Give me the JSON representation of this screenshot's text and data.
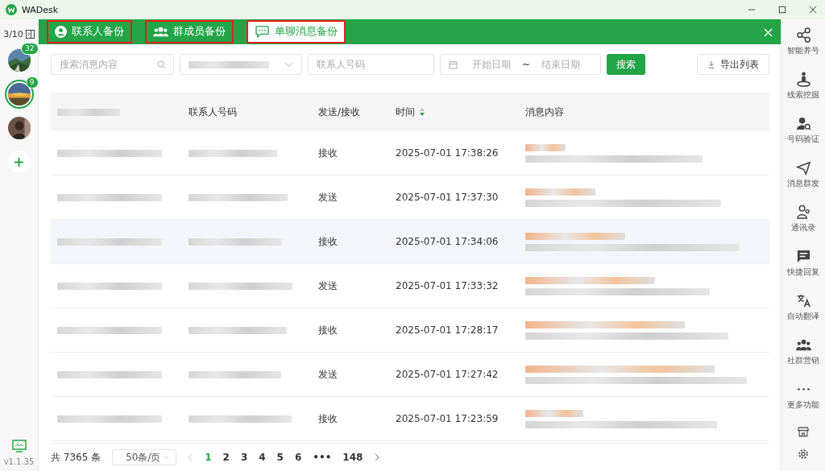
{
  "window": {
    "title": "WADesk"
  },
  "left_sidebar": {
    "account_count": "3/10",
    "accounts": [
      {
        "badge": "32",
        "selected": false,
        "kind": "picture"
      },
      {
        "badge": "9",
        "selected": true,
        "kind": "picture"
      },
      {
        "selected": false,
        "kind": "picture"
      }
    ],
    "version": "v1.1.35"
  },
  "tabs": [
    {
      "label": "联系人备份",
      "selected": false,
      "highlighted": true
    },
    {
      "label": "群成员备份",
      "selected": false,
      "highlighted": true
    },
    {
      "label": "单聊消息备份",
      "selected": true,
      "highlighted": true
    }
  ],
  "filters": {
    "search": {
      "placeholder": "搜索消息内容"
    },
    "contact_number": {
      "placeholder": "联系人号码"
    },
    "date_range": {
      "start_placeholder": "开始日期",
      "separator": "~",
      "end_placeholder": "结束日期"
    },
    "search_button": "搜索",
    "export_button": "导出列表"
  },
  "table": {
    "columns": [
      {
        "label": "联系人号码",
        "sorted": false
      },
      {
        "label": "发送/接收",
        "sorted": false
      },
      {
        "label": "时间",
        "sorted": true
      },
      {
        "label": "消息内容",
        "sorted": false
      }
    ],
    "rows": [
      {
        "direction": "接收",
        "time": "2025-07-01 17:38:26",
        "selected": false
      },
      {
        "direction": "发送",
        "time": "2025-07-01 17:37:30",
        "selected": false
      },
      {
        "direction": "接收",
        "time": "2025-07-01 17:34:06",
        "selected": true
      },
      {
        "direction": "发送",
        "time": "2025-07-01 17:33:32",
        "selected": false
      },
      {
        "direction": "接收",
        "time": "2025-07-01 17:28:17",
        "selected": false
      },
      {
        "direction": "发送",
        "time": "2025-07-01 17:27:42",
        "selected": false
      },
      {
        "direction": "接收",
        "time": "2025-07-01 17:23:59",
        "selected": false
      }
    ]
  },
  "pagination": {
    "total": "共 7365 条",
    "page_size": "50条/页",
    "pages": [
      {
        "label": "1",
        "selected": true
      },
      {
        "label": "2",
        "selected": false
      },
      {
        "label": "3",
        "selected": false
      },
      {
        "label": "4",
        "selected": false
      },
      {
        "label": "5",
        "selected": false
      },
      {
        "label": "6",
        "selected": false
      },
      {
        "label": "•••",
        "selected": false
      },
      {
        "label": "148",
        "selected": false
      }
    ]
  },
  "right_sidebar": [
    {
      "label": "智能养号"
    },
    {
      "label": "线索挖掘"
    },
    {
      "label": "号码验证"
    },
    {
      "label": "消息群发"
    },
    {
      "label": "通讯录"
    },
    {
      "label": "快捷回复"
    },
    {
      "label": "自动翻译"
    },
    {
      "label": "社群营销"
    },
    {
      "label": "更多功能"
    }
  ]
}
